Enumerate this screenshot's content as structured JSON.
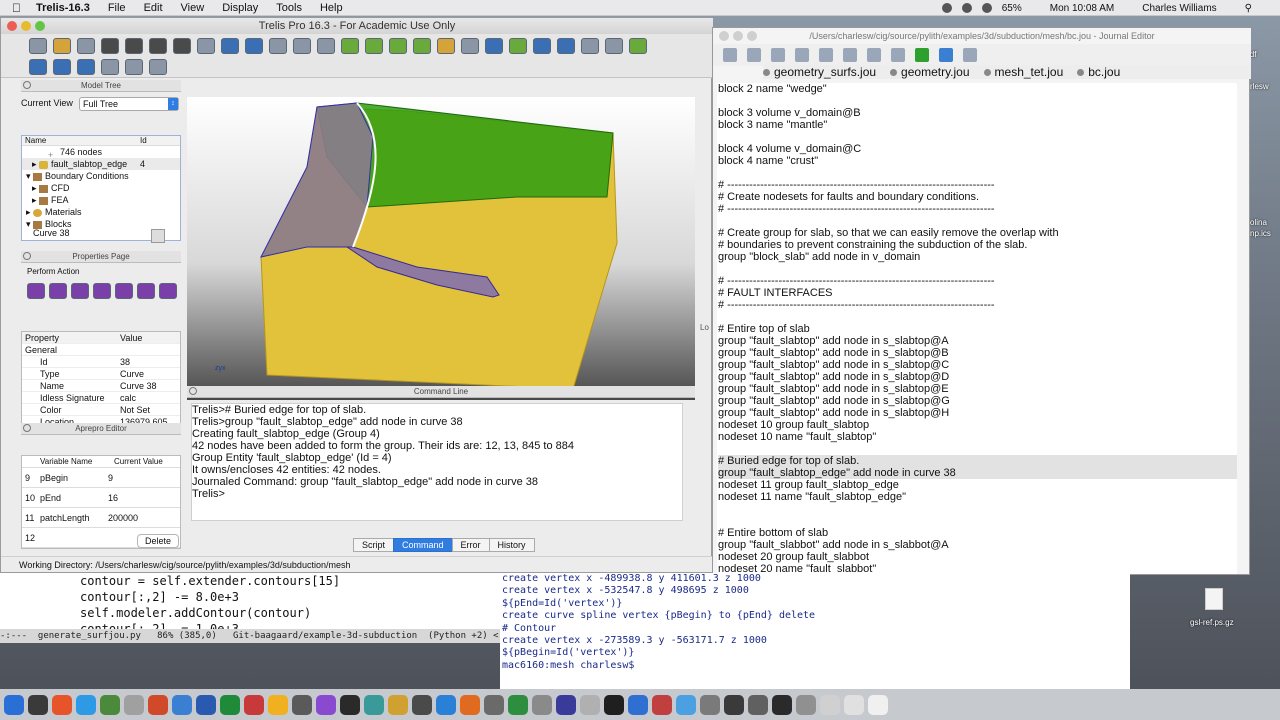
{
  "menubar": {
    "app": "Trelis-16.3",
    "items": [
      "File",
      "Edit",
      "View",
      "Display",
      "Tools",
      "Help"
    ],
    "battery": "65%",
    "clock": "Mon 10:08 AM",
    "user": "Charles Williams"
  },
  "trelis": {
    "title": "Trelis Pro  16.3 - For Academic Use Only",
    "model_tree": {
      "header": "Model Tree",
      "current_view_label": "Current View",
      "current_view": "Full Tree",
      "col_name": "Name",
      "col_id": "Id",
      "rows": [
        {
          "label": "746 nodes",
          "id": ""
        },
        {
          "label": "fault_slabtop_edge",
          "id": "4"
        },
        {
          "label": "Boundary Conditions",
          "id": ""
        },
        {
          "label": "CFD",
          "id": ""
        },
        {
          "label": "FEA",
          "id": ""
        },
        {
          "label": "Materials",
          "id": ""
        },
        {
          "label": "Blocks",
          "id": ""
        }
      ],
      "selected": "Curve 38"
    },
    "properties": {
      "header": "Properties Page",
      "perform_action": "Perform Action",
      "col_property": "Property",
      "col_value": "Value",
      "group": "General",
      "rows": [
        {
          "k": "Id",
          "v": "38"
        },
        {
          "k": "Type",
          "v": "Curve"
        },
        {
          "k": "Name",
          "v": "Curve 38"
        },
        {
          "k": "Idless Signature",
          "v": "calc"
        },
        {
          "k": "Color",
          "v": "Not Set"
        },
        {
          "k": "Location",
          "v": "136979.605."
        }
      ]
    },
    "aprepro": {
      "header": "Aprepro Editor",
      "col_name": "Variable Name",
      "col_value": "Current Value",
      "rows": [
        {
          "n": "9",
          "name": "pBegin",
          "val": "9"
        },
        {
          "n": "10",
          "name": "pEnd",
          "val": "16"
        },
        {
          "n": "11",
          "name": "patchLength",
          "val": "200000"
        },
        {
          "n": "12",
          "name": "",
          "val": ""
        }
      ],
      "delete": "Delete"
    },
    "axes": {
      "x": "x",
      "y": "y",
      "z": "z"
    },
    "command": {
      "header": "Command Line",
      "lines": [
        "Trelis># Buried edge for top of slab.",
        "Trelis>group \"fault_slabtop_edge\" add node in curve 38",
        "Creating fault_slabtop_edge (Group 4)",
        "42 nodes have been added to form the group. Their ids are: 12, 13, 845 to 884",
        "Group Entity 'fault_slabtop_edge' (Id = 4)",
        "It owns/encloses 42 entities: 42 nodes.",
        "Journaled Command: group \"fault_slabtop_edge\" add node in curve 38",
        "",
        "Trelis>"
      ],
      "tabs": [
        "Script",
        "Command",
        "Error",
        "History"
      ]
    },
    "working_dir": "Working Directory: /Users/charlesw/cig/source/pylith/examples/3d/subduction/mesh",
    "side_label": "Lo"
  },
  "journal": {
    "title": "/Users/charlesw/cig/source/pylith/examples/3d/subduction/mesh/bc.jou - Journal Editor",
    "tabs": [
      "geometry_surfs.jou",
      "geometry.jou",
      "mesh_tet.jou",
      "bc.jou"
    ],
    "lines": [
      "block 2 name \"wedge\"",
      "",
      "block 3 volume v_domain@B",
      "block 3 name \"mantle\"",
      "",
      "block 4 volume v_domain@C",
      "block 4 name \"crust\"",
      "",
      "# -------------------------------------------------------------------------",
      "# Create nodesets for faults and boundary conditions.",
      "# -------------------------------------------------------------------------",
      "",
      "# Create group for slab, so that we can easily remove the overlap with",
      "# boundaries to prevent constraining the subduction of the slab.",
      "group \"block_slab\" add node in v_domain",
      "",
      "# -------------------------------------------------------------------------",
      "# FAULT INTERFACES",
      "# -------------------------------------------------------------------------",
      "",
      "# Entire top of slab",
      "group \"fault_slabtop\" add node in s_slabtop@A",
      "group \"fault_slabtop\" add node in s_slabtop@B",
      "group \"fault_slabtop\" add node in s_slabtop@C",
      "group \"fault_slabtop\" add node in s_slabtop@D",
      "group \"fault_slabtop\" add node in s_slabtop@E",
      "group \"fault_slabtop\" add node in s_slabtop@G",
      "group \"fault_slabtop\" add node in s_slabtop@H",
      "nodeset 10 group fault_slabtop",
      "nodeset 10 name \"fault_slabtop\"",
      "",
      "# Buried edge for top of slab.",
      "group \"fault_slabtop_edge\" add node in curve 38",
      "nodeset 11 group fault_slabtop_edge",
      "nodeset 11 name \"fault_slabtop_edge\"",
      "",
      "",
      "# Entire bottom of slab",
      "group \"fault_slabbot\" add node in s_slabbot@A",
      "nodeset 20 group fault_slabbot",
      "nodeset 20 name \"fault_slabbot\""
    ]
  },
  "emacs": {
    "lines": [
      "contour = self.extender.contours[15]",
      "contour[:,2] -= 8.0e+3",
      "self.modeler.addContour(contour)",
      "contour[:,2] -= 1.0e+3"
    ],
    "modeline": "-:---  generate_surfjou.py   86% (385,0)   Git-baagaard/example-3d-subduction  (Python +2) <"
  },
  "terminal": {
    "lines": [
      "create vertex x -489938.8 y 411601.3 z 1000",
      "create vertex x -532547.8 y 498695 z 1000",
      "${pEnd=Id('vertex')}",
      "create curve spline vertex {pBegin} to {pEnd} delete",
      "# Contour",
      "create vertex x -273589.3 y -563171.7 z 1000",
      "${pBegin=Id('vertex')}",
      "mac6160:mesh charlesw$ "
    ]
  },
  "desktop": {
    "icon1": "fold_pdf",
    "icon2": "olina",
    "icon3": "gsl-ref.ps.gz",
    "icon4": "rlesw",
    "icon5": "np.ics"
  },
  "colors": {
    "accent": "#2f7de1",
    "green_block": "#2e9e12",
    "yellow_block": "#e0c136"
  }
}
